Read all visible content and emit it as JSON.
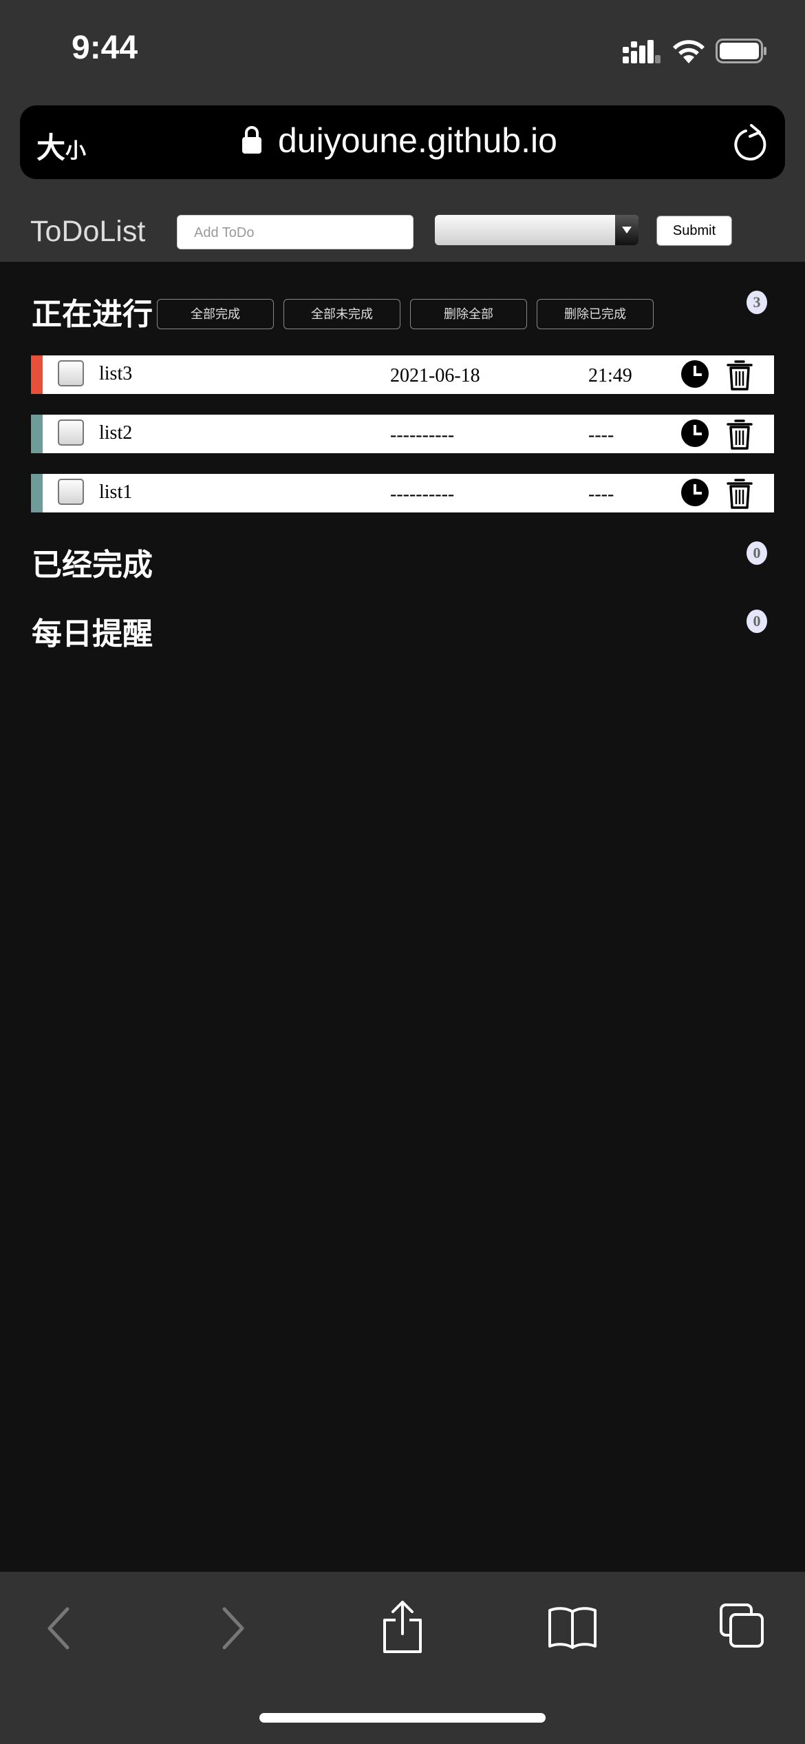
{
  "status_bar": {
    "time": "9:44"
  },
  "browser": {
    "text_size_label": "大",
    "text_size_small": "小",
    "url": "duiyoune.github.io"
  },
  "app": {
    "title": "ToDoList",
    "input_placeholder": "Add ToDo",
    "select_value": "",
    "submit_label": "Submit"
  },
  "sections": {
    "in_progress": {
      "title": "正在进行",
      "count": "3",
      "actions": [
        "全部完成",
        "全部未完成",
        "删除全部",
        "删除已完成"
      ]
    },
    "completed": {
      "title": "已经完成",
      "count": "0"
    },
    "daily": {
      "title": "每日提醒",
      "count": "0"
    }
  },
  "todos": [
    {
      "name": "list3",
      "date": "2021-06-18",
      "time": "21:49",
      "stripe_color": "#e8503a"
    },
    {
      "name": "list2",
      "date": "----------",
      "time": "----",
      "stripe_color": "#6f9c9a"
    },
    {
      "name": "list1",
      "date": "----------",
      "time": "----",
      "stripe_color": "#6f9c9a"
    }
  ],
  "icons": {
    "toolbar": [
      "back-icon",
      "forward-icon",
      "share-icon",
      "bookmarks-icon",
      "tabs-icon"
    ],
    "row": [
      "clock-icon",
      "trash-icon"
    ]
  },
  "colors": {
    "chrome": "#333333",
    "page_background": "#111111",
    "badge": "#e6e6fa"
  }
}
